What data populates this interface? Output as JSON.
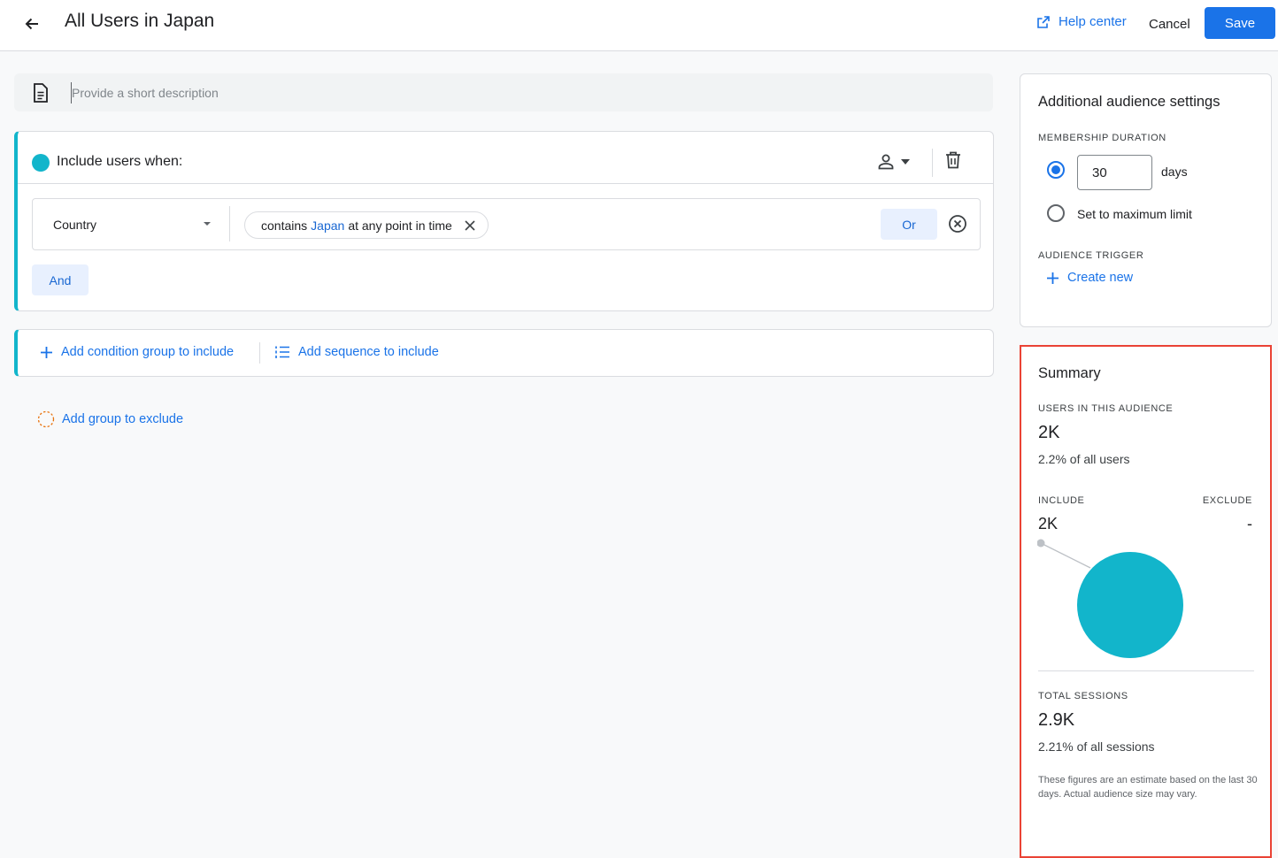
{
  "header": {
    "title": "All Users in Japan",
    "help_label": "Help center",
    "cancel_label": "Cancel",
    "save_label": "Save"
  },
  "description": {
    "placeholder": "Provide a short description",
    "value": ""
  },
  "include_group": {
    "title": "Include users when:",
    "condition": {
      "dimension": "Country",
      "operator": "contains",
      "value": "Japan",
      "scope": "at any point in time"
    },
    "or_label": "Or",
    "and_label": "And"
  },
  "add_actions": {
    "add_condition_group": "Add condition group to include",
    "add_sequence": "Add sequence to include",
    "add_exclude": "Add group to exclude"
  },
  "settings": {
    "title": "Additional audience settings",
    "membership_label": "MEMBERSHIP DURATION",
    "duration_value": "30",
    "duration_unit": "days",
    "max_limit_label": "Set to maximum limit",
    "trigger_label": "AUDIENCE TRIGGER",
    "create_new_label": "Create new"
  },
  "summary": {
    "title": "Summary",
    "users_label": "USERS IN THIS AUDIENCE",
    "users_value": "2K",
    "users_pct": "2.2% of all users",
    "include_label": "INCLUDE",
    "include_value": "2K",
    "exclude_label": "EXCLUDE",
    "exclude_value": "-",
    "sessions_label": "TOTAL SESSIONS",
    "sessions_value": "2.9K",
    "sessions_pct": "2.21% of all sessions",
    "note": "These figures are an estimate based on the last 30 days. Actual audience size may vary."
  },
  "colors": {
    "accent": "#1a73e8",
    "teal": "#12b5cb",
    "highlight_border": "#ea4335"
  }
}
